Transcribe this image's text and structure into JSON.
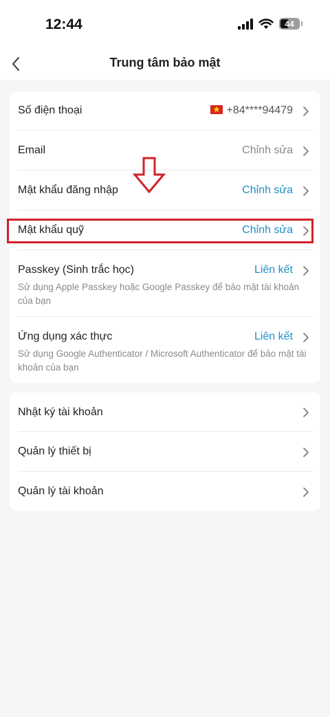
{
  "status_bar": {
    "time": "12:44",
    "battery_level": "44"
  },
  "header": {
    "title": "Trung tâm bảo mật"
  },
  "security_section": {
    "phone": {
      "label": "Số điện thoại",
      "value": "+84****94479"
    },
    "email": {
      "label": "Email",
      "value": "Chỉnh sửa"
    },
    "login_password": {
      "label": "Mật khẩu đăng nhập",
      "value": "Chỉnh sửa"
    },
    "fund_password": {
      "label": "Mật khẩu quỹ",
      "value": "Chỉnh sửa"
    },
    "passkey": {
      "label": "Passkey (Sinh trắc học)",
      "value": "Liên kết",
      "description": "Sử dụng Apple Passkey hoặc Google Passkey để bảo mật tài khoản của bạn"
    },
    "authenticator": {
      "label": "Ứng dụng xác thực",
      "value": "Liên kết",
      "description": "Sử dụng Google Authenticator / Microsoft Authenticator để bảo mật tài khoản của bạn"
    }
  },
  "account_section": {
    "activity_log": {
      "label": "Nhật ký tài khoản"
    },
    "device_management": {
      "label": "Quản lý thiết bị"
    },
    "account_management": {
      "label": "Quản lý tài khoản"
    }
  },
  "colors": {
    "accent_blue": "#1f8fc2",
    "highlight_red": "#d0222a",
    "background": "#f5f6f8"
  },
  "icons": [
    "back-icon",
    "chevron-right-icon",
    "vietnam-flag-icon",
    "wifi-icon",
    "signal-icon",
    "battery-icon",
    "down-arrow-annotation"
  ]
}
